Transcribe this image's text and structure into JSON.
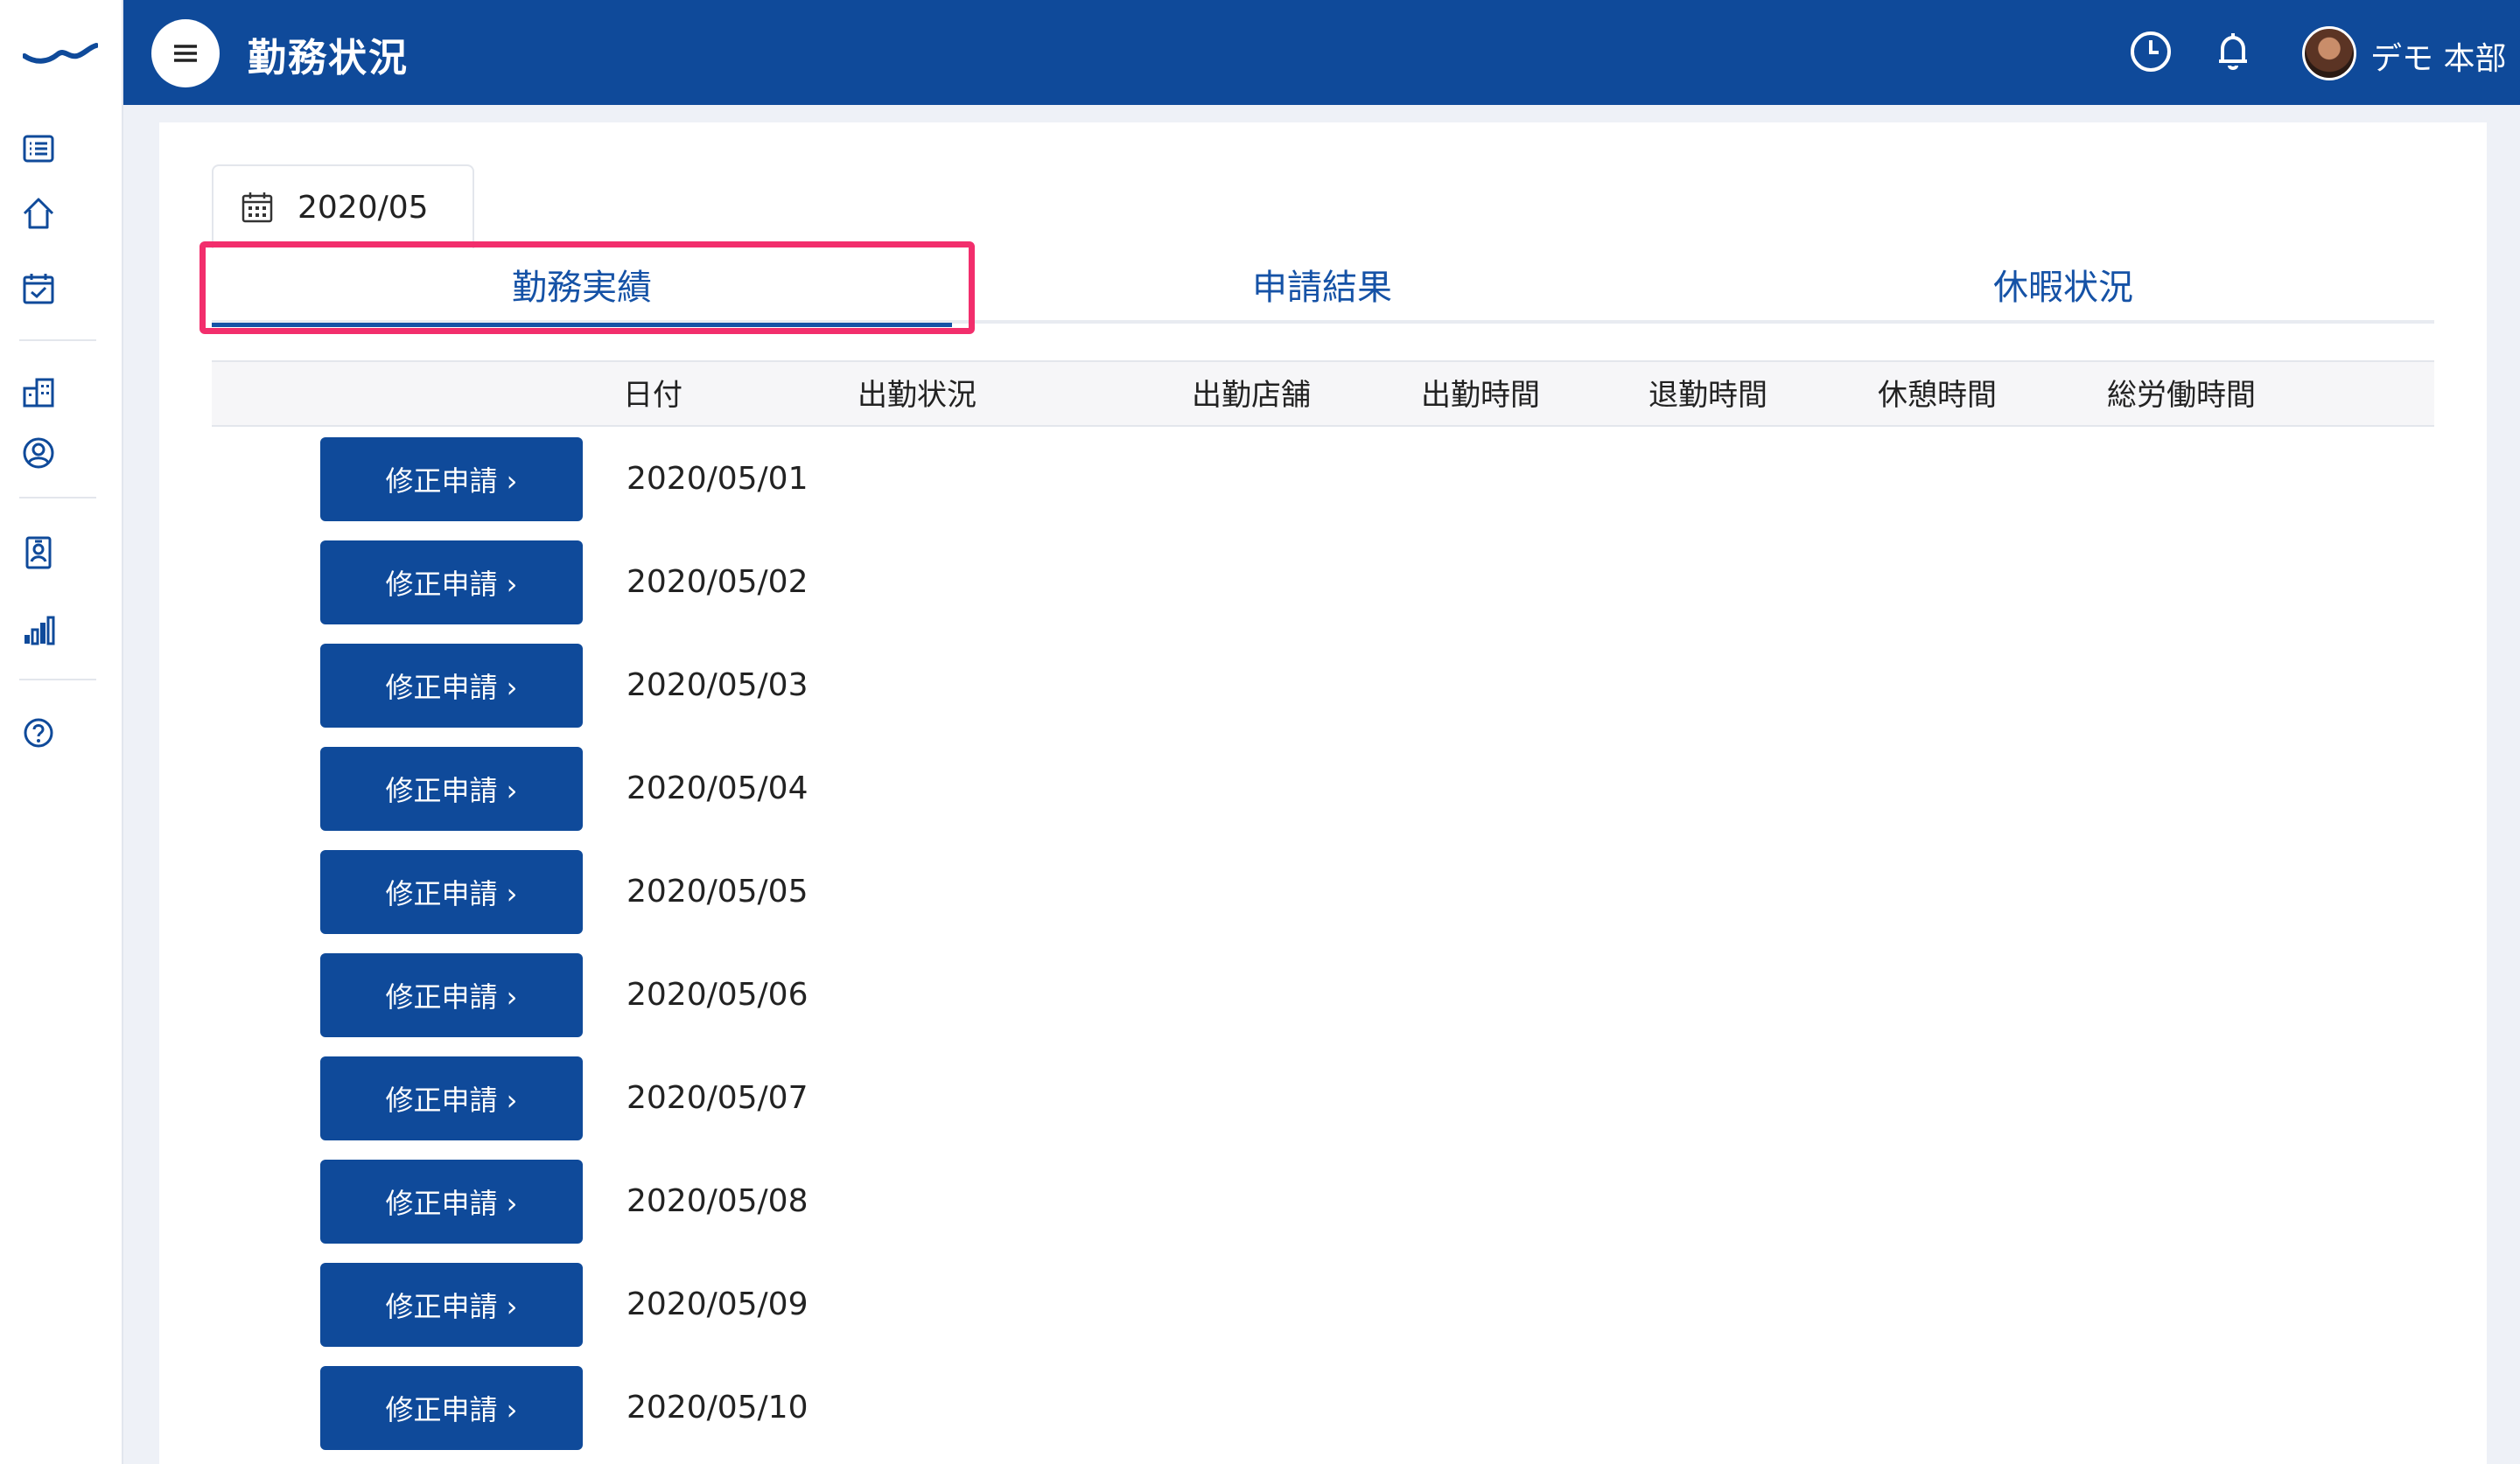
{
  "header": {
    "title": "勤務状況",
    "user_name": "デモ 本部",
    "icons": [
      "menu-icon",
      "clock-icon",
      "bell-icon"
    ]
  },
  "sidebar": {
    "icons": [
      "logo-icon",
      "list-icon",
      "home-icon",
      "calendar-check-icon",
      "building-icon",
      "user-circle-icon",
      "id-badge-icon",
      "bar-chart-icon",
      "help-icon"
    ]
  },
  "date_picker": {
    "value": "2020/05",
    "icon": "calendar-icon"
  },
  "tabs": [
    {
      "label": "勤務実績",
      "active": true
    },
    {
      "label": "申請結果",
      "active": false
    },
    {
      "label": "休暇状況",
      "active": false
    }
  ],
  "table": {
    "columns": [
      "日付",
      "出勤状況",
      "出勤店舗",
      "出勤時間",
      "退勤時間",
      "休憩時間",
      "総労働時間"
    ],
    "button_label": "修正申請 ›",
    "rows": [
      {
        "date": "2020/05/01"
      },
      {
        "date": "2020/05/02"
      },
      {
        "date": "2020/05/03"
      },
      {
        "date": "2020/05/04"
      },
      {
        "date": "2020/05/05"
      },
      {
        "date": "2020/05/06"
      },
      {
        "date": "2020/05/07"
      },
      {
        "date": "2020/05/08"
      },
      {
        "date": "2020/05/09"
      },
      {
        "date": "2020/05/10"
      }
    ]
  },
  "colors": {
    "primary": "#0f4a9a",
    "tab_text": "#1552a6",
    "highlight": "#f22e6c",
    "background": "#eef1f7"
  }
}
